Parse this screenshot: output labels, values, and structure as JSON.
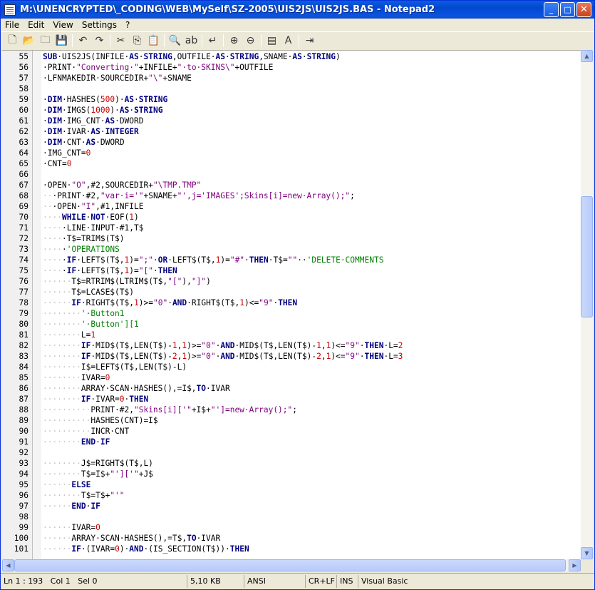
{
  "window": {
    "title": "M:\\UNENCRYPTED\\_CODING\\WEB\\MySelf\\SZ-2005\\UIS2JS\\UIS2JS.BAS - Notepad2"
  },
  "menu": [
    {
      "label": "File"
    },
    {
      "label": "Edit"
    },
    {
      "label": "View"
    },
    {
      "label": "Settings"
    },
    {
      "label": "?"
    }
  ],
  "toolbar": [
    {
      "icon": "new-file-icon",
      "glyph": "🗋"
    },
    {
      "icon": "open-file-icon",
      "glyph": "📂"
    },
    {
      "icon": "browse-icon",
      "glyph": "🗀"
    },
    {
      "icon": "save-icon",
      "glyph": "💾"
    },
    {
      "sep": true
    },
    {
      "icon": "undo-icon",
      "glyph": "↶"
    },
    {
      "icon": "redo-icon",
      "glyph": "↷"
    },
    {
      "sep": true
    },
    {
      "icon": "cut-icon",
      "glyph": "✂"
    },
    {
      "icon": "copy-icon",
      "glyph": "⎘"
    },
    {
      "icon": "paste-icon",
      "glyph": "📋"
    },
    {
      "sep": true
    },
    {
      "icon": "find-icon",
      "glyph": "🔍"
    },
    {
      "icon": "replace-icon",
      "glyph": "ab"
    },
    {
      "sep": true
    },
    {
      "icon": "word-wrap-icon",
      "glyph": "↵"
    },
    {
      "sep": true
    },
    {
      "icon": "zoom-in-icon",
      "glyph": "⊕"
    },
    {
      "icon": "zoom-out-icon",
      "glyph": "⊖"
    },
    {
      "sep": true
    },
    {
      "icon": "scheme-icon",
      "glyph": "▤"
    },
    {
      "icon": "font-icon",
      "glyph": "A"
    },
    {
      "sep": true
    },
    {
      "icon": "exit-icon",
      "glyph": "⇥"
    }
  ],
  "editor": {
    "lines": [
      {
        "n": "55",
        "indent": 0,
        "segs": [
          [
            "kw",
            "SUB"
          ],
          [
            "",
            "·UIS2JS(INFILE·"
          ],
          [
            "kw",
            "AS"
          ],
          [
            "",
            "·"
          ],
          [
            "kw",
            "STRING"
          ],
          [
            "",
            ",OUTFILE·"
          ],
          [
            "kw",
            "AS"
          ],
          [
            "",
            "·"
          ],
          [
            "kw",
            "STRING"
          ],
          [
            "",
            ",SNAME·"
          ],
          [
            "kw",
            "AS"
          ],
          [
            "",
            "·"
          ],
          [
            "kw",
            "STRING"
          ],
          [
            "",
            ")"
          ]
        ]
      },
      {
        "n": "56",
        "indent": 0,
        "segs": [
          [
            "",
            "·PRINT·"
          ],
          [
            "str",
            "\"Converting·\""
          ],
          [
            "",
            "+INFILE+"
          ],
          [
            "str",
            "\"·to·SKINS\\\""
          ],
          [
            "",
            "+OUTFILE"
          ]
        ]
      },
      {
        "n": "57",
        "indent": 0,
        "segs": [
          [
            "",
            "·LFNMAKEDIR·SOURCEDIR+"
          ],
          [
            "str",
            "\"\\\""
          ],
          [
            "",
            "+SNAME"
          ]
        ]
      },
      {
        "n": "58",
        "indent": 0,
        "segs": []
      },
      {
        "n": "59",
        "indent": 0,
        "segs": [
          [
            "",
            "·"
          ],
          [
            "kw",
            "DIM"
          ],
          [
            "",
            "·HASHES("
          ],
          [
            "num",
            "500"
          ],
          [
            "",
            ")·"
          ],
          [
            "kw",
            "AS"
          ],
          [
            "",
            "·"
          ],
          [
            "kw",
            "STRING"
          ]
        ]
      },
      {
        "n": "60",
        "indent": 0,
        "segs": [
          [
            "",
            "·"
          ],
          [
            "kw",
            "DIM"
          ],
          [
            "",
            "·IMGS("
          ],
          [
            "num",
            "1000"
          ],
          [
            "",
            ")·"
          ],
          [
            "kw",
            "AS"
          ],
          [
            "",
            "·"
          ],
          [
            "kw",
            "STRING"
          ]
        ]
      },
      {
        "n": "61",
        "indent": 0,
        "segs": [
          [
            "",
            "·"
          ],
          [
            "kw",
            "DIM"
          ],
          [
            "",
            "·IMG_CNT·"
          ],
          [
            "kw",
            "AS"
          ],
          [
            "",
            "·DWORD"
          ]
        ]
      },
      {
        "n": "62",
        "indent": 0,
        "segs": [
          [
            "",
            "·"
          ],
          [
            "kw",
            "DIM"
          ],
          [
            "",
            "·IVAR·"
          ],
          [
            "kw",
            "AS"
          ],
          [
            "",
            "·"
          ],
          [
            "kw",
            "INTEGER"
          ]
        ]
      },
      {
        "n": "63",
        "indent": 0,
        "segs": [
          [
            "",
            "·"
          ],
          [
            "kw",
            "DIM"
          ],
          [
            "",
            "·CNT·"
          ],
          [
            "kw",
            "AS"
          ],
          [
            "",
            "·DWORD"
          ]
        ]
      },
      {
        "n": "64",
        "indent": 0,
        "segs": [
          [
            "",
            "·IMG_CNT="
          ],
          [
            "num",
            "0"
          ]
        ]
      },
      {
        "n": "65",
        "indent": 0,
        "segs": [
          [
            "",
            "·CNT="
          ],
          [
            "num",
            "0"
          ]
        ]
      },
      {
        "n": "66",
        "indent": 0,
        "segs": []
      },
      {
        "n": "67",
        "indent": 0,
        "segs": [
          [
            "",
            "·OPEN·"
          ],
          [
            "str",
            "\"O\""
          ],
          [
            "",
            ",#2,SOURCEDIR+"
          ],
          [
            "str",
            "\"\\TMP.TMP\""
          ]
        ]
      },
      {
        "n": "68",
        "indent": 1,
        "segs": [
          [
            "",
            "·PRINT·#2,"
          ],
          [
            "str",
            "\"var·i='\""
          ],
          [
            "",
            "+SNAME+"
          ],
          [
            "str",
            "\"',j='IMAGES';Skins[i]=new·Array();\""
          ],
          [
            "",
            ";"
          ]
        ]
      },
      {
        "n": "69",
        "indent": 1,
        "segs": [
          [
            "",
            "·OPEN·"
          ],
          [
            "str",
            "\"I\""
          ],
          [
            "",
            ",#1,INFILE"
          ]
        ]
      },
      {
        "n": "70",
        "indent": 2,
        "segs": [
          [
            "kw",
            "WHILE"
          ],
          [
            "",
            "·"
          ],
          [
            "kw",
            "NOT"
          ],
          [
            "",
            "·EOF("
          ],
          [
            "num",
            "1"
          ],
          [
            "",
            ")"
          ]
        ]
      },
      {
        "n": "71",
        "indent": 2,
        "segs": [
          [
            "",
            "·LINE·INPUT·#1,T$"
          ]
        ]
      },
      {
        "n": "72",
        "indent": 2,
        "segs": [
          [
            "",
            "·T$=TRIM$(T$)"
          ]
        ]
      },
      {
        "n": "73",
        "indent": 2,
        "segs": [
          [
            "",
            "·"
          ],
          [
            "cmt",
            "'OPERATIONS"
          ]
        ]
      },
      {
        "n": "74",
        "indent": 2,
        "segs": [
          [
            "",
            "·"
          ],
          [
            "kw",
            "IF"
          ],
          [
            "",
            "·LEFT$(T$,"
          ],
          [
            "num",
            "1"
          ],
          [
            "",
            ")="
          ],
          [
            "str",
            "\";\""
          ],
          [
            "",
            "·"
          ],
          [
            "kw",
            "OR"
          ],
          [
            "",
            "·LEFT$(T$,"
          ],
          [
            "num",
            "1"
          ],
          [
            "",
            ")="
          ],
          [
            "str",
            "\"#\""
          ],
          [
            "",
            "·"
          ],
          [
            "kw",
            "THEN"
          ],
          [
            "",
            "·T$="
          ],
          [
            "str",
            "\"\""
          ],
          [
            "",
            "··"
          ],
          [
            "cmt",
            "'DELETE·COMMENTS"
          ]
        ]
      },
      {
        "n": "75",
        "indent": 2,
        "segs": [
          [
            "",
            "·"
          ],
          [
            "kw",
            "IF"
          ],
          [
            "",
            "·LEFT$(T$,"
          ],
          [
            "num",
            "1"
          ],
          [
            "",
            ")="
          ],
          [
            "str",
            "\"[\""
          ],
          [
            "",
            "·"
          ],
          [
            "kw",
            "THEN"
          ]
        ]
      },
      {
        "n": "76",
        "indent": 3,
        "segs": [
          [
            "",
            "T$=RTRIM$(LTRIM$(T$,"
          ],
          [
            "str",
            "\"[\""
          ],
          [
            "",
            "),"
          ],
          [
            "str",
            "\"]\""
          ],
          [
            "",
            ")"
          ]
        ]
      },
      {
        "n": "77",
        "indent": 3,
        "segs": [
          [
            "",
            "T$=LCASE$(T$)"
          ]
        ]
      },
      {
        "n": "78",
        "indent": 3,
        "segs": [
          [
            "kw",
            "IF"
          ],
          [
            "",
            "·RIGHT$(T$,"
          ],
          [
            "num",
            "1"
          ],
          [
            "",
            ")>="
          ],
          [
            "str",
            "\"0\""
          ],
          [
            "",
            "·"
          ],
          [
            "kw",
            "AND"
          ],
          [
            "",
            "·RIGHT$(T$,"
          ],
          [
            "num",
            "1"
          ],
          [
            "",
            ")<="
          ],
          [
            "str",
            "\"9\""
          ],
          [
            "",
            "·"
          ],
          [
            "kw",
            "THEN"
          ]
        ]
      },
      {
        "n": "79",
        "indent": 4,
        "segs": [
          [
            "cmt",
            "'·Button1"
          ]
        ]
      },
      {
        "n": "80",
        "indent": 4,
        "segs": [
          [
            "cmt",
            "'·Button'][1"
          ]
        ]
      },
      {
        "n": "81",
        "indent": 4,
        "segs": [
          [
            "",
            "L="
          ],
          [
            "num",
            "1"
          ]
        ]
      },
      {
        "n": "82",
        "indent": 4,
        "segs": [
          [
            "kw",
            "IF"
          ],
          [
            "",
            "·MID$(T$,LEN(T$)-"
          ],
          [
            "num",
            "1"
          ],
          [
            "",
            ","
          ],
          [
            "num",
            "1"
          ],
          [
            "",
            ")>="
          ],
          [
            "str",
            "\"0\""
          ],
          [
            "",
            "·"
          ],
          [
            "kw",
            "AND"
          ],
          [
            "",
            "·MID$(T$,LEN(T$)-"
          ],
          [
            "num",
            "1"
          ],
          [
            "",
            ","
          ],
          [
            "num",
            "1"
          ],
          [
            "",
            ")<="
          ],
          [
            "str",
            "\"9\""
          ],
          [
            "",
            "·"
          ],
          [
            "kw",
            "THEN"
          ],
          [
            "",
            "·L="
          ],
          [
            "num",
            "2"
          ]
        ]
      },
      {
        "n": "83",
        "indent": 4,
        "segs": [
          [
            "kw",
            "IF"
          ],
          [
            "",
            "·MID$(T$,LEN(T$)-"
          ],
          [
            "num",
            "2"
          ],
          [
            "",
            ","
          ],
          [
            "num",
            "1"
          ],
          [
            "",
            ")>="
          ],
          [
            "str",
            "\"0\""
          ],
          [
            "",
            "·"
          ],
          [
            "kw",
            "AND"
          ],
          [
            "",
            "·MID$(T$,LEN(T$)-"
          ],
          [
            "num",
            "2"
          ],
          [
            "",
            ","
          ],
          [
            "num",
            "1"
          ],
          [
            "",
            ")<="
          ],
          [
            "str",
            "\"9\""
          ],
          [
            "",
            "·"
          ],
          [
            "kw",
            "THEN"
          ],
          [
            "",
            "·L="
          ],
          [
            "num",
            "3"
          ]
        ]
      },
      {
        "n": "84",
        "indent": 4,
        "segs": [
          [
            "",
            "I$=LEFT$(T$,LEN(T$)-L)"
          ]
        ]
      },
      {
        "n": "85",
        "indent": 4,
        "segs": [
          [
            "",
            "IVAR="
          ],
          [
            "num",
            "0"
          ]
        ]
      },
      {
        "n": "86",
        "indent": 4,
        "segs": [
          [
            "",
            "ARRAY·SCAN·HASHES(),=I$,"
          ],
          [
            "kw",
            "TO"
          ],
          [
            "",
            "·IVAR"
          ]
        ]
      },
      {
        "n": "87",
        "indent": 4,
        "segs": [
          [
            "kw",
            "IF"
          ],
          [
            "",
            "·IVAR="
          ],
          [
            "num",
            "0"
          ],
          [
            "",
            "·"
          ],
          [
            "kw",
            "THEN"
          ]
        ]
      },
      {
        "n": "88",
        "indent": 5,
        "segs": [
          [
            "",
            "PRINT·#2,"
          ],
          [
            "str",
            "\"Skins[i]['\""
          ],
          [
            "",
            "+I$+"
          ],
          [
            "str",
            "\"']=new·Array();\""
          ],
          [
            "",
            ";"
          ]
        ]
      },
      {
        "n": "89",
        "indent": 5,
        "segs": [
          [
            "",
            "HASHES(CNT)=I$"
          ]
        ]
      },
      {
        "n": "90",
        "indent": 5,
        "segs": [
          [
            "",
            "INCR·CNT"
          ]
        ]
      },
      {
        "n": "91",
        "indent": 4,
        "segs": [
          [
            "kw",
            "END"
          ],
          [
            "",
            "·"
          ],
          [
            "kw",
            "IF"
          ]
        ]
      },
      {
        "n": "92",
        "indent": 0,
        "segs": []
      },
      {
        "n": "93",
        "indent": 4,
        "segs": [
          [
            "",
            "J$=RIGHT$(T$,L)"
          ]
        ]
      },
      {
        "n": "94",
        "indent": 4,
        "segs": [
          [
            "",
            "T$=I$+"
          ],
          [
            "str",
            "\"']['\""
          ],
          [
            "",
            "+J$"
          ]
        ]
      },
      {
        "n": "95",
        "indent": 3,
        "segs": [
          [
            "kw",
            "ELSE"
          ]
        ]
      },
      {
        "n": "96",
        "indent": 4,
        "segs": [
          [
            "",
            "T$=T$+"
          ],
          [
            "str",
            "\"'\""
          ]
        ]
      },
      {
        "n": "97",
        "indent": 3,
        "segs": [
          [
            "kw",
            "END"
          ],
          [
            "",
            "·"
          ],
          [
            "kw",
            "IF"
          ]
        ]
      },
      {
        "n": "98",
        "indent": 0,
        "segs": []
      },
      {
        "n": "99",
        "indent": 3,
        "segs": [
          [
            "",
            "IVAR="
          ],
          [
            "num",
            "0"
          ]
        ]
      },
      {
        "n": "100",
        "indent": 3,
        "segs": [
          [
            "",
            "ARRAY·SCAN·HASHES(),=T$,"
          ],
          [
            "kw",
            "TO"
          ],
          [
            "",
            "·IVAR"
          ]
        ]
      },
      {
        "n": "101",
        "indent": 3,
        "segs": [
          [
            "kw",
            "IF"
          ],
          [
            "",
            "·(IVAR="
          ],
          [
            "num",
            "0"
          ],
          [
            "",
            ")·"
          ],
          [
            "kw",
            "AND"
          ],
          [
            "",
            "·(IS_SECTION(T$))·"
          ],
          [
            "kw",
            "THEN"
          ]
        ]
      }
    ]
  },
  "scrollbars": {
    "up": "▲",
    "down": "▼",
    "left": "◀",
    "right": "▶"
  },
  "status": {
    "position": "Ln 1 : 193   Col 1   Sel 0",
    "size": "5,10 KB",
    "encoding": "ANSI",
    "eol": "CR+LF",
    "mode": "INS",
    "lexer": "Visual Basic"
  }
}
